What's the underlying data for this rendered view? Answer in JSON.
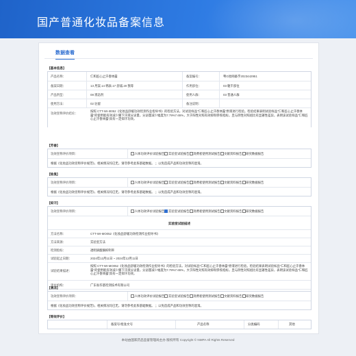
{
  "header": {
    "title": "国产普通化妆品备案信息"
  },
  "tab": {
    "label": "数据查看"
  },
  "basic": {
    "title": "【基本信息】",
    "rows": [
      {
        "l1": "产品名称：",
        "v1": "仁和匠心止汗香体露",
        "l2": "备案编号：",
        "v2": "粤G妆网备字2023442951"
      },
      {
        "l1": "备案日期：",
        "v1": "13 月案.14 韩表.17 舒诚.20 我等",
        "l2": "作用部位：",
        "v2": "03 躯干部位"
      },
      {
        "l1": "产品剂型：",
        "v1": "08 液态剂",
        "l2": "使用人群：",
        "v2": "03 普通人群"
      },
      {
        "l1": "使用方法：",
        "v1": "02 驻留",
        "l2": "备注说明：",
        "v2": ""
      }
    ],
    "claim_label": "功效宣称评价结论：",
    "claim_text": "按照 CTT-WI-I0052《化妆品舒缓功效检测作业指导书》的检验方法，对试验样品“仁和匠心止汗香体露”原液进行检验。检验结果表明试验样品“仁和匠心止汗香体露”的使用能有效减少腋下汗液分泌量，分泌量减少幅度为7.79%7.65%，大于阳性对照有效抑制参照指标，且与阴性对照组比有显著性差异，表明该试验样品“仁和匠心止汗香体露”具有一定抑汗功效。"
  },
  "s2": {
    "title": "【芳香】",
    "label": "功效宣称评价项目：",
    "options": [
      "人体功效评价试验报告",
      "实验室试验报告",
      "消费者使用测试报告",
      "文献资料报告",
      "研究数据报告"
    ],
    "checked": [
      false,
      false,
      false,
      false,
      false
    ],
    "note": "根据《化妆品功效宣称评价规范》，相关情况均已无，请勿参考此系基础数据。 ；以免造成产品和功效宣称的混淆。"
  },
  "s3": {
    "title": "【除臭】",
    "label": "功效宣称评价项目：",
    "options": [
      "人体功效评价试验报告",
      "实验室试验报告",
      "消费者使用测试报告",
      "文献资料报告",
      "研究数据报告"
    ],
    "checked": [
      false,
      false,
      false,
      false,
      false
    ],
    "note": "根据《化妆品功效宣称评价规范》，相关情况均已无，请勿参考此系基础数据。 ；以免造成产品和功效宣称的混淆。"
  },
  "s4": {
    "title": "【抑汗】",
    "label": "功效宣称评价项目：",
    "options": [
      "人体功效评价试验报告",
      "实验室试验报告",
      "消费者使用测试报告",
      "文献资料报告",
      "研究数据报告"
    ],
    "checked": [
      false,
      true,
      false,
      false,
      false
    ],
    "inner_title": "实验室试验描述",
    "rows": [
      {
        "l": "方法名称：",
        "v": "CTT-WI-MO052《化妆品舒缓功效检测作业指导书》"
      },
      {
        "l": "方法来源：",
        "v": "实验室方法"
      },
      {
        "l": "检测指标：",
        "v": "透明质酸酶抑制率"
      },
      {
        "l": "试验起止日期：",
        "v": "2024年12月11日 ~ 2024年12月11日"
      }
    ],
    "result_label": "试验结果描述：",
    "result_text": "按照 CTT-WI-MO052《化妆品舒缓功效检测作业指导书》的检验方法，对试验样品“仁和匠心止汗香体露”原液进行检验。检验结果表明试验样品“仁和匠心止汗香体露”的使用能有效减少腋下汗液分泌量，分泌量减少幅度为7.79%7.65%，大于阳性对照有效抑制参照指标，且与阴性对照组比有显著性差异，表明该试验样品“仁和匠心止汗香体露”具有一定抑汗功效。",
    "org_label": "评价机构：",
    "org_value": "广东省华基检测技术有限公司",
    "addr_label": "地址：",
    "addr_value": "广东省东莞市松山湖高新技术产业开发区工业北四路7号"
  },
  "s5": {
    "title": "【清凉】",
    "label": "功效宣称评价项目：",
    "options": [
      "人体功效评价试验报告",
      "实验室试验报告",
      "消费者使用测试报告",
      "文献资料报告",
      "研究数据报告"
    ],
    "checked": [
      false,
      false,
      false,
      false,
      false
    ],
    "note": "根据《化妆品功效宣称评价规范》，相关情况均已无，请勿参考此系基础数据。 ；以免造成产品和功效宣称的混淆。"
  },
  "s6": {
    "title": "【等效评价】",
    "headers": [
      "备案号/批准文号",
      "产品名称",
      "分类编码",
      "其他"
    ]
  },
  "footer": {
    "text": "本站由国家药品监督管理局主办  版权所有 Copyright © NMPA All Rights Reserved"
  }
}
